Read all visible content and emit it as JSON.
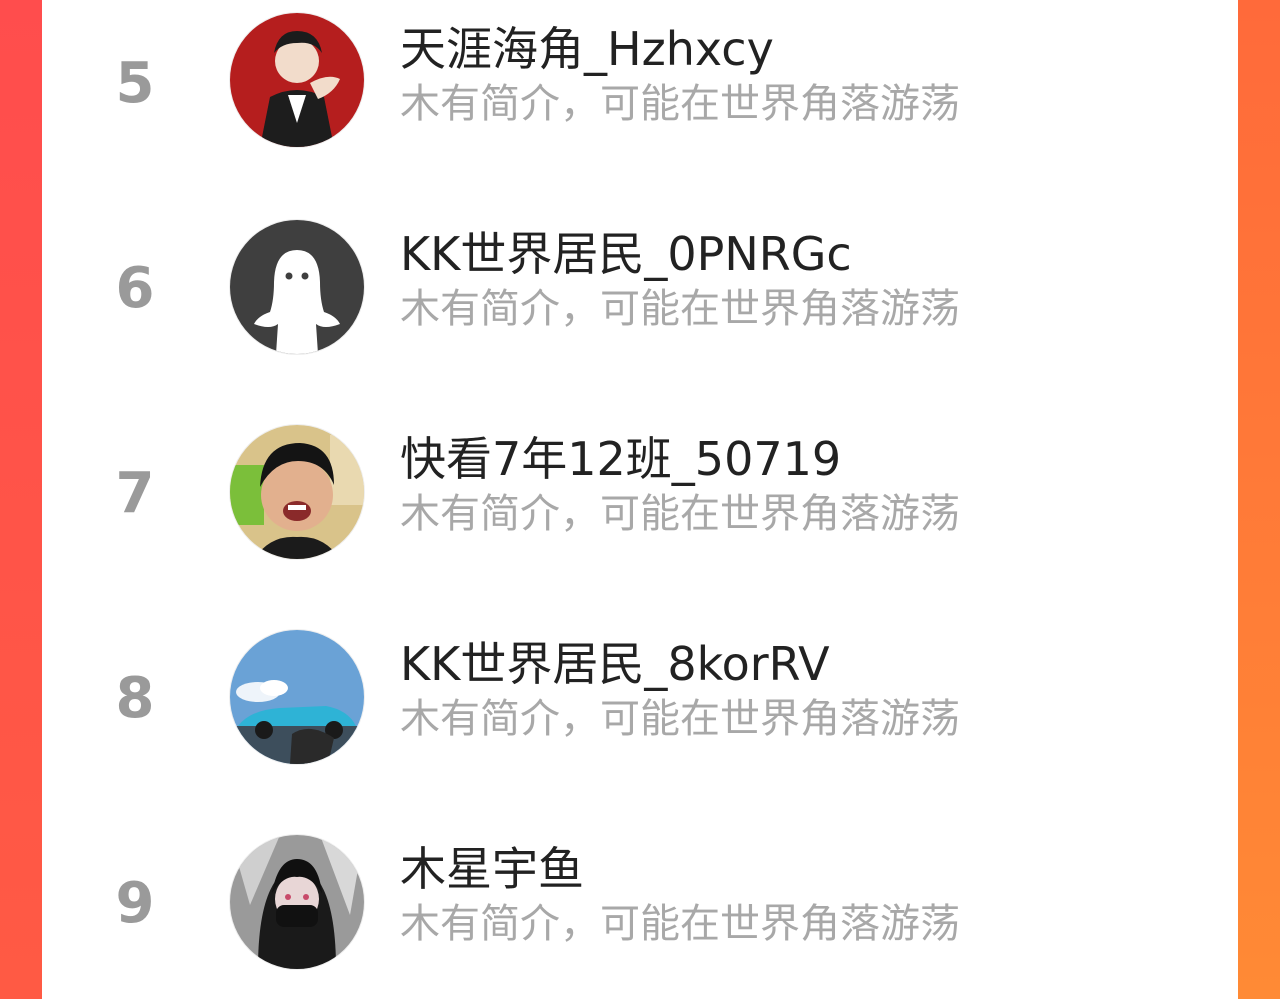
{
  "ranking": {
    "rows": [
      {
        "rank": "5",
        "name": "天涯海角_Hzhxcy",
        "bio": "木有简介，可能在世界角落游荡"
      },
      {
        "rank": "6",
        "name": "KK世界居民_0PNRGc",
        "bio": "木有简介，可能在世界角落游荡"
      },
      {
        "rank": "7",
        "name": "快看7年12班_50719",
        "bio": "木有简介，可能在世界角落游荡"
      },
      {
        "rank": "8",
        "name": "KK世界居民_8korRV",
        "bio": "木有简介，可能在世界角落游荡"
      },
      {
        "rank": "9",
        "name": "木星宇鱼",
        "bio": "木有简介，可能在世界角落游荡"
      }
    ]
  },
  "colors": {
    "rank_gray": "#9a9a9a",
    "name_text": "#222222",
    "bio_text": "#a8a8a8",
    "frame_orange": "#ff6a3e"
  }
}
